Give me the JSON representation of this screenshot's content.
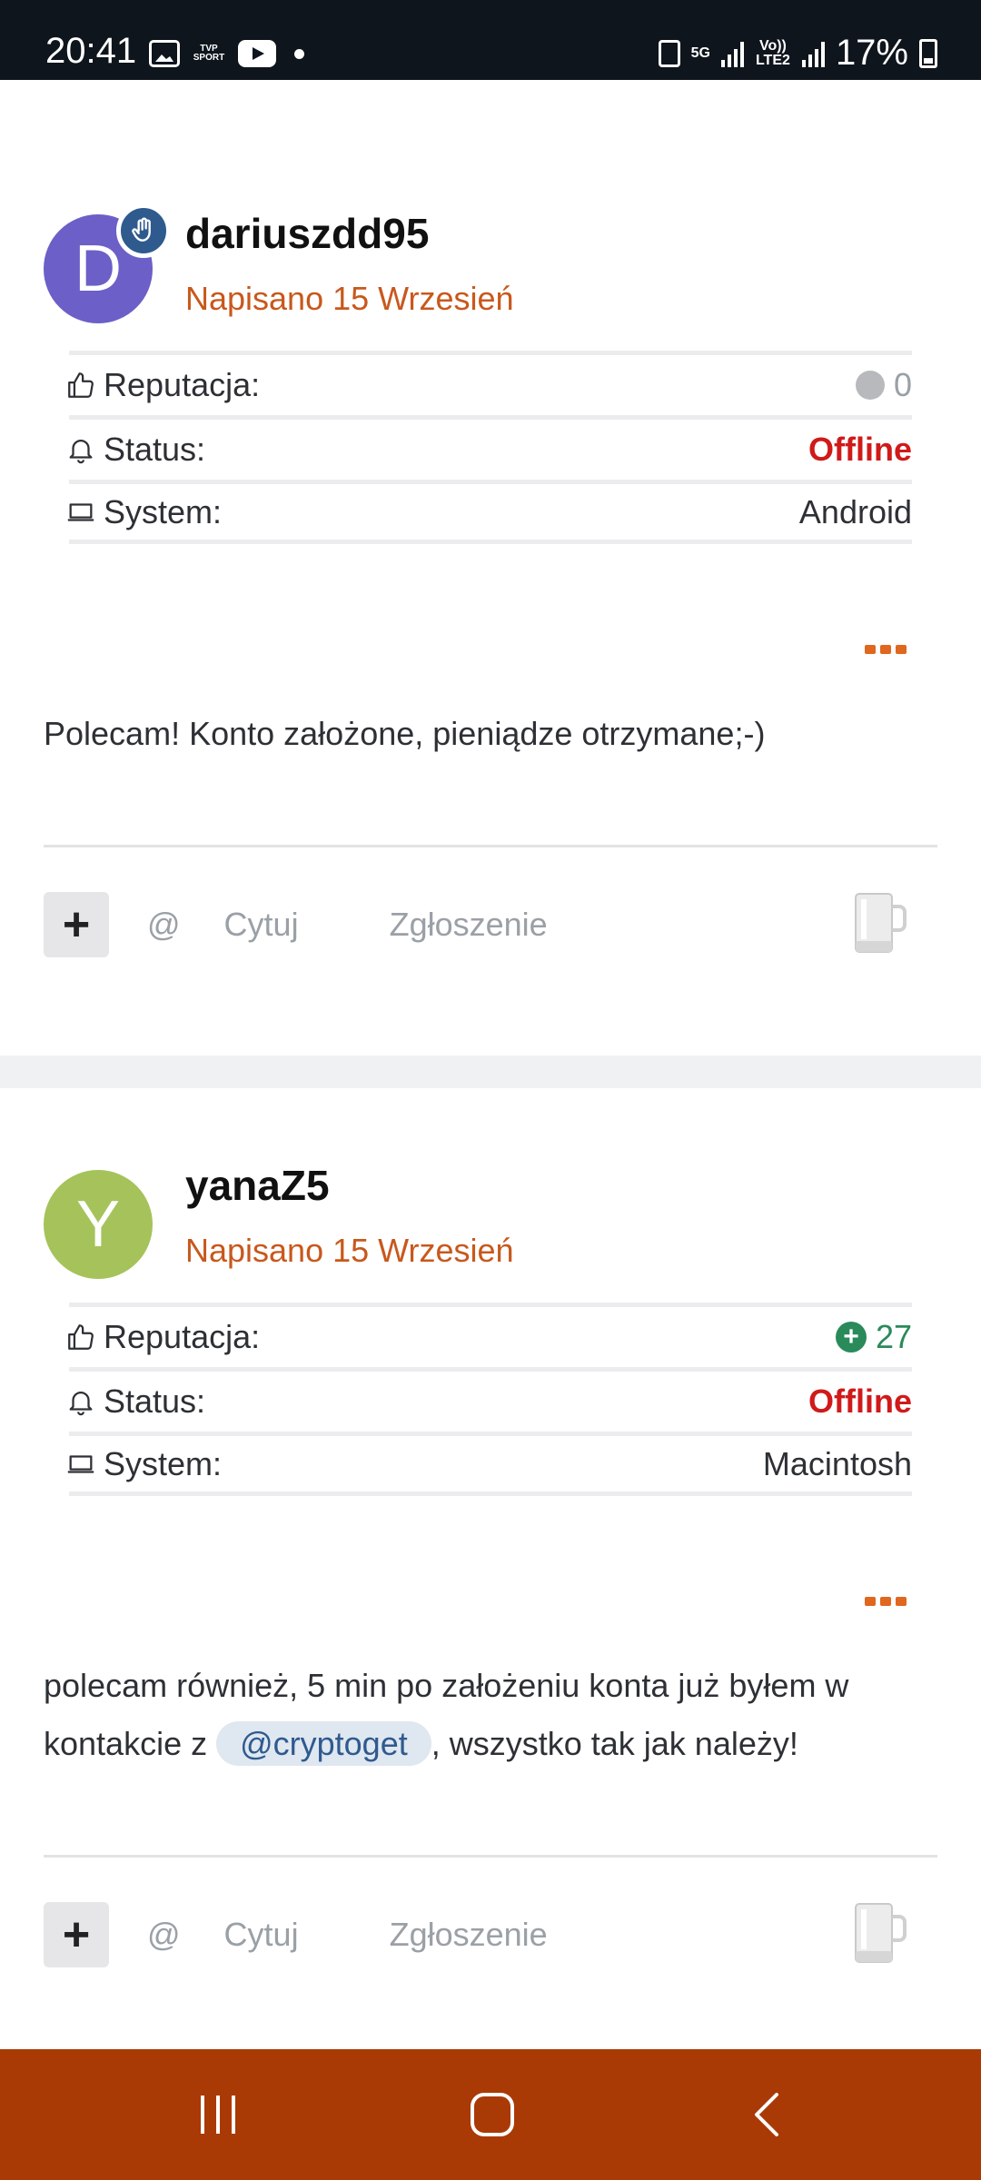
{
  "status_bar": {
    "time": "20:41",
    "tvp_label": "TVP SPORT",
    "network_label": "5G",
    "volte_label": "Vo)) LTE2",
    "battery": "17%",
    "icons": [
      "gallery-icon",
      "tvp-sport-icon",
      "youtube-icon",
      "notification-dot-icon",
      "save-icon",
      "signal-icon",
      "battery-icon"
    ]
  },
  "posts": [
    {
      "avatar_letter": "D",
      "avatar_color": "#6c5fc7",
      "has_badge": true,
      "username": "dariuszdd95",
      "posted": "Napisano 15 Wrzesień",
      "info": {
        "reputation_label": "Reputacja:",
        "reputation_value": "0",
        "status_label": "Status:",
        "status_value": "Offline",
        "system_label": "System:",
        "system_value": "Android"
      },
      "body": "Polecam! Konto założone,  pieniądze otrzymane;-)",
      "actions": {
        "at": "@",
        "quote": "Cytuj",
        "report": "Zgłoszenie"
      }
    },
    {
      "avatar_letter": "Y",
      "avatar_color": "#a5c35a",
      "has_badge": false,
      "username": "yanaZ5",
      "posted": "Napisano 15 Wrzesień",
      "info": {
        "reputation_label": "Reputacja:",
        "reputation_value": "27",
        "status_label": "Status:",
        "status_value": "Offline",
        "system_label": "System:",
        "system_value": "Macintosh"
      },
      "body_before": "polecam również, 5 min po założeniu konta już byłem w kontakcie z ",
      "mention": "@cryptoget",
      "body_after": ", wszystko tak jak należy!",
      "actions": {
        "at": "@",
        "quote": "Cytuj",
        "report": "Zgłoszenie"
      }
    }
  ],
  "colors": {
    "accent": "#c8581c",
    "offline": "#d01a1a",
    "positive": "#2a8a5a",
    "navbar": "#a93a06"
  }
}
